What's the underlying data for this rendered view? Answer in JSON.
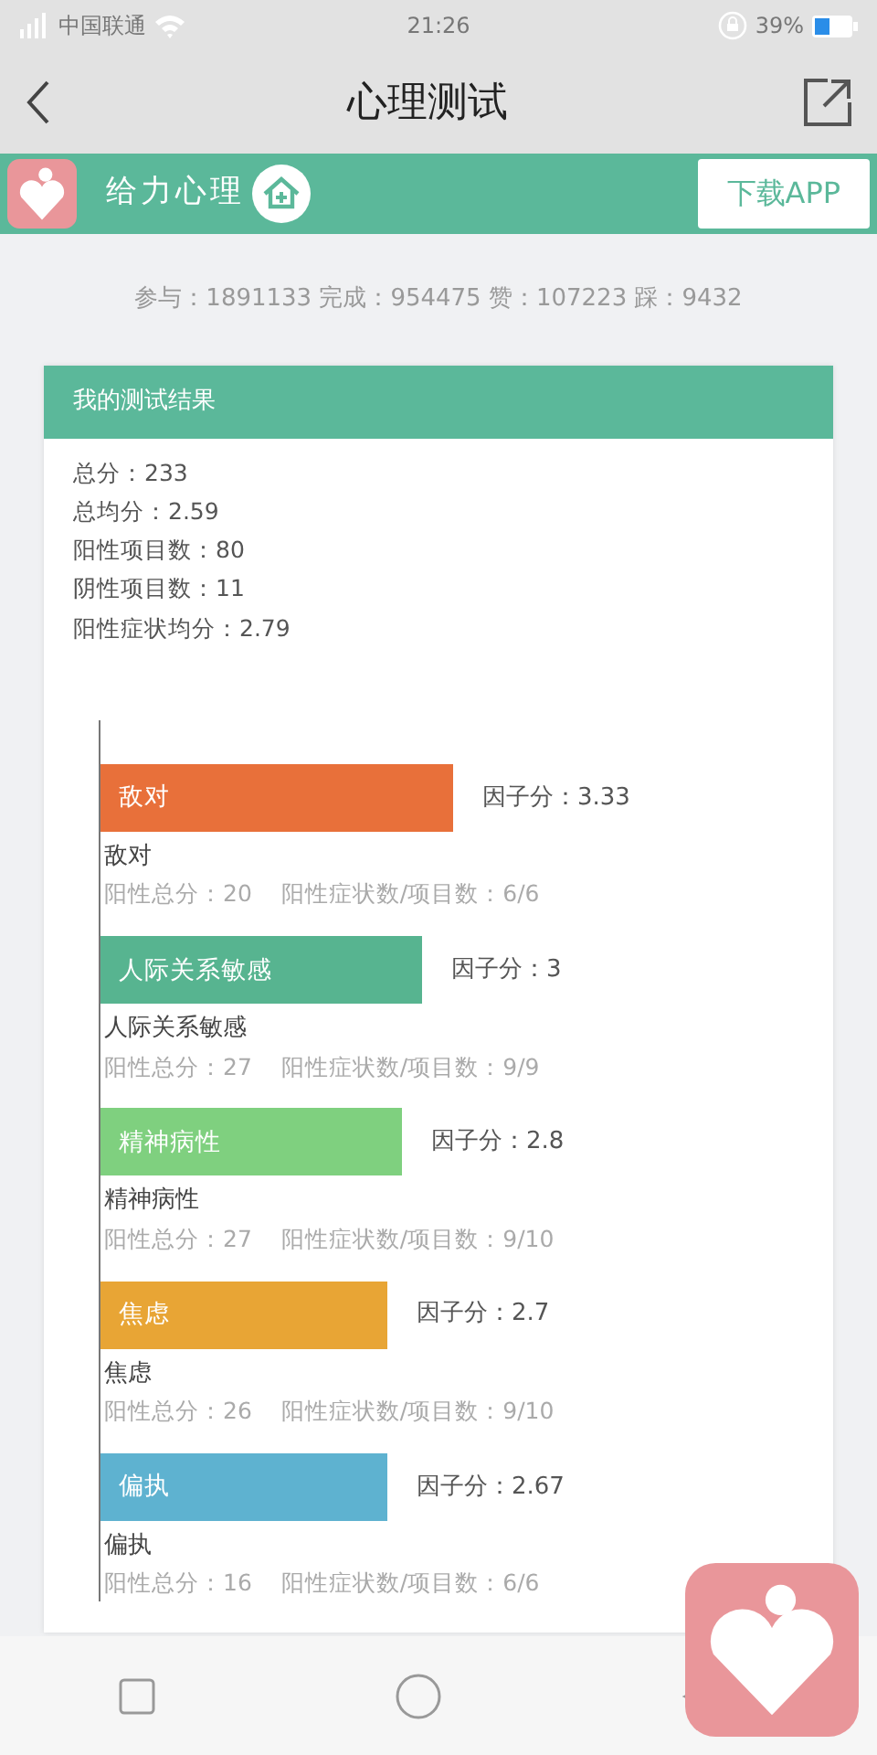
{
  "status_bar": {
    "carrier": "中国联通",
    "time": "21:26",
    "battery": "39%"
  },
  "nav_bar": {
    "title": "心理测试"
  },
  "banner": {
    "brand": "给力心理",
    "download_button": "下载APP"
  },
  "stats": "参与：1891133 完成：954475 赞：107223 踩：9432",
  "result_card": {
    "title": "我的测试结果",
    "summary": [
      "总分：233",
      "总均分：2.59",
      "阳性项目数：80",
      "阴性项目数：11",
      "阳性症状均分：2.79"
    ],
    "factors": [
      {
        "name": "敌对",
        "score": "因子分：3.33",
        "color": "#e8703a",
        "label": "敌对",
        "detail_total": "阳性总分：20",
        "detail_ratio": "阳性症状数/项目数：6/6"
      },
      {
        "name": "人际关系敏感",
        "score": "因子分：3",
        "color": "#57b490",
        "label": "人际关系敏感",
        "detail_total": "阳性总分：27",
        "detail_ratio": "阳性症状数/项目数：9/9"
      },
      {
        "name": "精神病性",
        "score": "因子分：2.8",
        "color": "#7fd07f",
        "label": "精神病性",
        "detail_total": "阳性总分：27",
        "detail_ratio": "阳性症状数/项目数：9/10"
      },
      {
        "name": "焦虑",
        "score": "因子分：2.7",
        "color": "#e8a535",
        "label": "焦虑",
        "detail_total": "阳性总分：26",
        "detail_ratio": "阳性症状数/项目数：9/10"
      },
      {
        "name": "偏执",
        "score": "因子分：2.67",
        "color": "#5eb2d0",
        "label": "偏执",
        "detail_total": "阳性总分：16",
        "detail_ratio": "阳性症状数/项目数：6/6"
      }
    ]
  }
}
